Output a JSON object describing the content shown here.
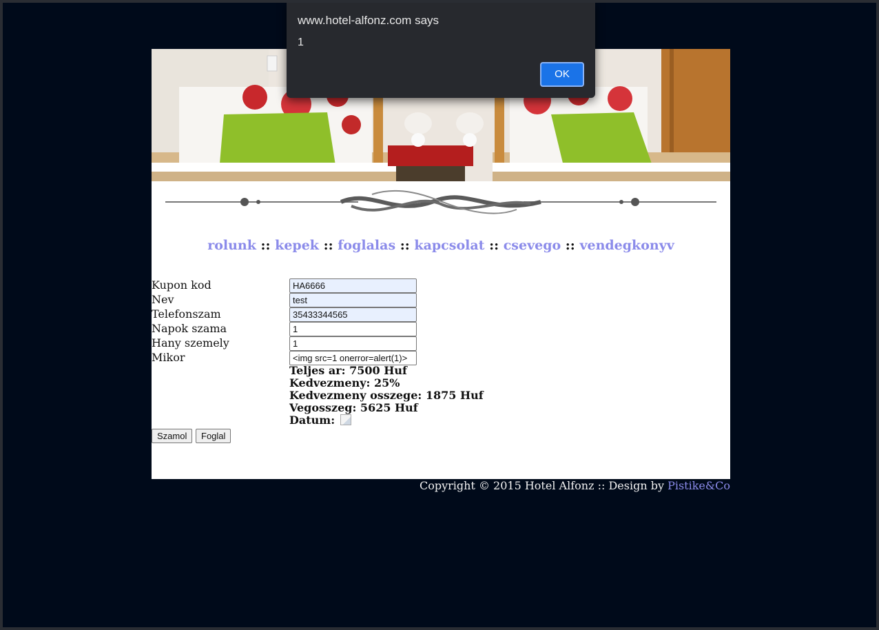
{
  "alert": {
    "title": "www.hotel-alfonz.com says",
    "message": "1",
    "ok_label": "OK"
  },
  "nav": {
    "items": [
      {
        "label": "rolunk"
      },
      {
        "label": "kepek"
      },
      {
        "label": "foglalas"
      },
      {
        "label": "kapcsolat"
      },
      {
        "label": "csevego"
      },
      {
        "label": "vendegkonyv"
      }
    ],
    "separator": "::"
  },
  "form": {
    "fields": [
      {
        "label": "Kupon kod",
        "value": "HA6666"
      },
      {
        "label": "Nev",
        "value": "test"
      },
      {
        "label": "Telefonszam",
        "value": "35433344565"
      },
      {
        "label": "Napok szama",
        "value": "1"
      },
      {
        "label": "Hany szemely",
        "value": "1"
      },
      {
        "label": "Mikor",
        "value": "<img src=1 onerror=alert(1)>"
      }
    ],
    "summary": {
      "total": "Teljes ar: 7500 Huf",
      "discount": "Kedvezmeny: 25%",
      "discount_amount": "Kedvezmeny osszege: 1875 Huf",
      "final": "Vegosszeg: 5625 Huf",
      "date_label": "Datum:"
    },
    "buttons": {
      "calculate": "Szamol",
      "book": "Foglal"
    }
  },
  "footer": {
    "text": "Copyright © 2015 Hotel Alfonz :: Design by ",
    "link": "Pistike&Co"
  },
  "colors": {
    "background": "#000a1a",
    "link": "#8b8bea",
    "autofill": "#e8f0fe",
    "dialog_bg": "#27292e",
    "dialog_button": "#1a73e8"
  }
}
